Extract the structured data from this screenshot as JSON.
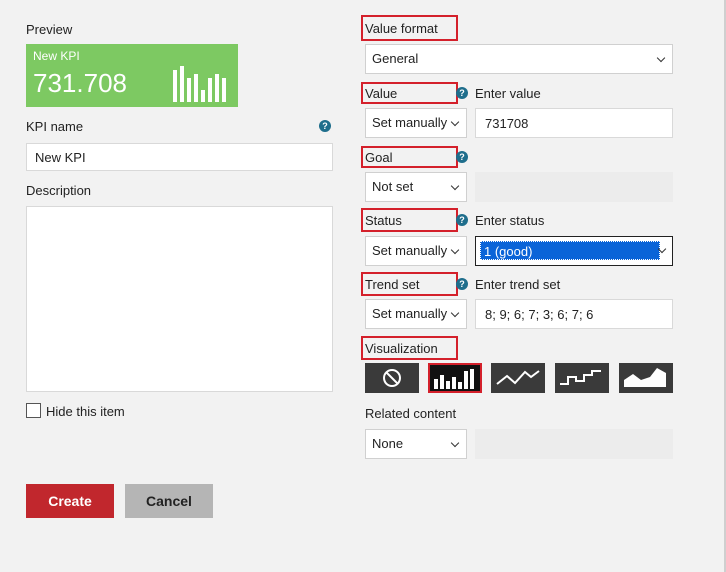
{
  "preview": {
    "heading": "Preview",
    "tile_title": "New KPI",
    "tile_value": "731.708",
    "tile_color": "#7dc962",
    "trend_values": [
      8,
      9,
      6,
      7,
      3,
      6,
      7,
      6
    ]
  },
  "kpi_name": {
    "label": "KPI name",
    "value": "New KPI",
    "help": "?"
  },
  "description": {
    "label": "Description",
    "value": ""
  },
  "hide_item": {
    "label": "Hide this item",
    "checked": false
  },
  "value_format": {
    "label": "Value format",
    "selected": "General"
  },
  "value": {
    "label": "Value",
    "help": "?",
    "mode": "Set manually",
    "entry_label": "Enter value",
    "entry_value": "731708"
  },
  "goal": {
    "label": "Goal",
    "help": "?",
    "mode": "Not set"
  },
  "status": {
    "label": "Status",
    "help": "?",
    "mode": "Set manually",
    "entry_label": "Enter status",
    "selected": "1 (good)"
  },
  "trend_set": {
    "label": "Trend set",
    "help": "?",
    "mode": "Set manually",
    "entry_label": "Enter trend set",
    "entry_value": "8; 9; 6; 7; 3; 6; 7; 6"
  },
  "visualization": {
    "label": "Visualization",
    "options": [
      "none-icon",
      "bar-chart-icon",
      "line-chart-icon",
      "step-chart-icon",
      "area-chart-icon"
    ],
    "selected": "bar-chart-icon"
  },
  "related_content": {
    "label": "Related content",
    "selected": "None"
  },
  "buttons": {
    "create": "Create",
    "cancel": "Cancel"
  },
  "colors": {
    "accent_red": "#c1272d",
    "highlight_red": "#d4202b",
    "select_blue": "#0a64d8",
    "help_blue": "#1f6e8c"
  }
}
